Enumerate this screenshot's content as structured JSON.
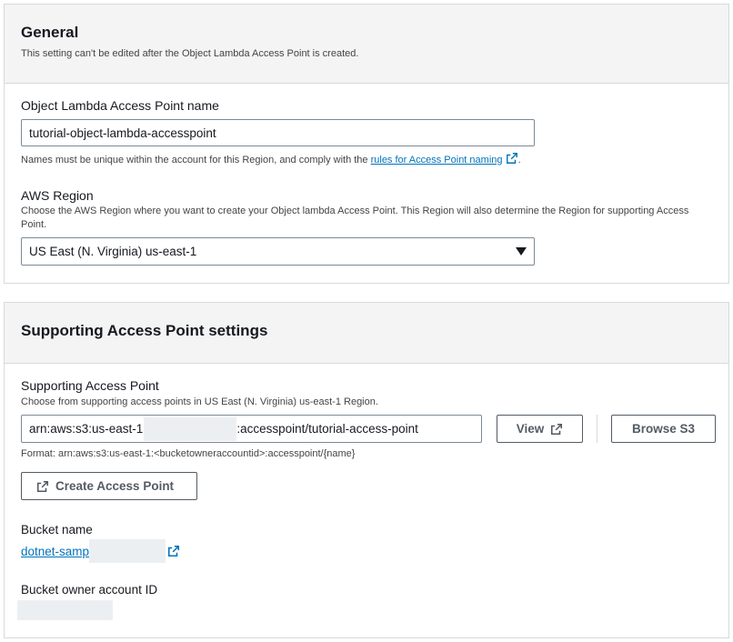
{
  "general": {
    "title": "General",
    "description": "This setting can't be edited after the Object Lambda Access Point is created.",
    "name_label": "Object Lambda Access Point name",
    "name_value": "tutorial-object-lambda-accesspoint",
    "name_hint_prefix": "Names must be unique within the account for this Region, and comply with the ",
    "name_hint_link": "rules for Access Point naming",
    "name_hint_suffix": ".",
    "region_label": "AWS Region",
    "region_hint": "Choose the AWS Region where you want to create your Object lambda Access Point. This Region will also determine the Region for supporting Access Point.",
    "region_value": "US East (N. Virginia) us-east-1"
  },
  "supporting": {
    "title": "Supporting Access Point settings",
    "ap_label": "Supporting Access Point",
    "ap_hint": "Choose from supporting access points in US East (N. Virginia) us-east-1 Region.",
    "arn_prefix": "arn:aws:s3:us-east-1",
    "arn_suffix": ":accesspoint/tutorial-access-point",
    "view_label": "View",
    "browse_label": "Browse S3",
    "format_hint": "Format: arn:aws:s3:us-east-1:<bucketowneraccountid>:accesspoint/{name}",
    "create_label": "Create Access Point",
    "bucket_label": "Bucket name",
    "bucket_value": "dotnet-samp",
    "owner_label": "Bucket owner account ID"
  },
  "icons": {
    "external_link": "external-link-icon",
    "dropdown": "caret-down-icon"
  },
  "colors": {
    "link": "#0073bb",
    "border": "#7d8998",
    "header_bg": "#f4f4f4"
  }
}
